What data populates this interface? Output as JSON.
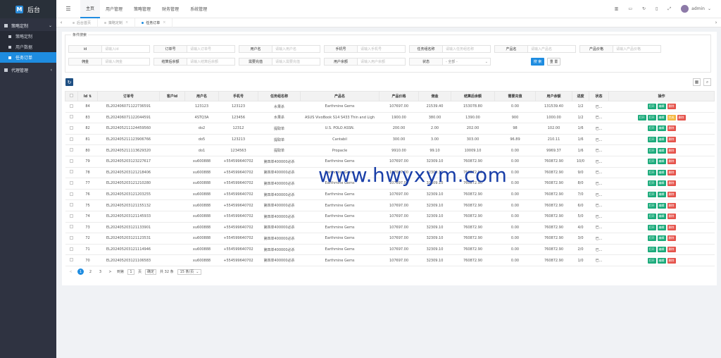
{
  "app": {
    "brand": "后台",
    "brand_logo": "M"
  },
  "sidebar": {
    "groups": [
      {
        "label": "策略定制",
        "expanded": true,
        "items": [
          {
            "label": "策略定制",
            "active": false
          },
          {
            "label": "用户数据",
            "active": false
          },
          {
            "label": "任务订单",
            "active": true
          }
        ]
      },
      {
        "label": "代理管理",
        "expanded": false,
        "items": []
      }
    ]
  },
  "topbar": {
    "nav": [
      "主页",
      "用户管理",
      "策略管理",
      "财务管理",
      "系统管理"
    ],
    "user": "admin"
  },
  "tabs": [
    {
      "label": "后台首页",
      "active": false
    },
    {
      "label": "策略定制",
      "active": false,
      "closable": true
    },
    {
      "label": "任务订单",
      "active": true,
      "closable": true
    }
  ],
  "search": {
    "legend": "条件搜索",
    "row1": [
      {
        "label": "id",
        "placeholder": "请输入id"
      },
      {
        "label": "订单号",
        "placeholder": "请输入订单号"
      },
      {
        "label": "用户名",
        "placeholder": "请输入用户名"
      },
      {
        "label": "手机号",
        "placeholder": "请输入手机号"
      },
      {
        "label": "任务组名称",
        "placeholder": "请输入任务组名称"
      },
      {
        "label": "产品名",
        "placeholder": "请输入产品名"
      },
      {
        "label": "产品价格",
        "placeholder": "请输入产品价格"
      }
    ],
    "row2": [
      {
        "label": "佣金",
        "placeholder": "请输入佣金"
      },
      {
        "label": "结算后余额",
        "placeholder": "请输入结算后余额"
      },
      {
        "label": "需要充值",
        "placeholder": "请输入需要充值"
      },
      {
        "label": "用户余额",
        "placeholder": "请输入用户余额"
      },
      {
        "label": "状态",
        "placeholder": "- 全部 -"
      }
    ],
    "search_btn": "搜 索",
    "reset_btn": "重 置"
  },
  "table": {
    "columns": [
      "Id",
      "订单号",
      "客户id",
      "用户名",
      "手机号",
      "任务组名称",
      "产品名",
      "产品价格",
      "佣金",
      "结算后余额",
      "需要充值",
      "用户余额",
      "进度",
      "状态",
      "操作"
    ],
    "actions": {
      "open": "打开",
      "edit": "编辑",
      "delete": "删除",
      "extra": "完成"
    },
    "rows": [
      [
        "84",
        "EL202406071122736591",
        "",
        "123123",
        "123123",
        "水果杀",
        "Earthmine Gems",
        "107697.00",
        "21539.40",
        "153078.80",
        "0.00",
        "131539.40",
        "1/2",
        "已..."
      ],
      [
        "83",
        "EL202406071122044591",
        "",
        "4STQ3A",
        "123456",
        "水果杀",
        "ASUS VivoBook S14 S433 Thin and Ligh",
        "1900.00",
        "380.00",
        "1390.00",
        "900",
        "1000.00",
        "1/2",
        "已..."
      ],
      [
        "82",
        "EL202405211124459560",
        "",
        "do2",
        "12312",
        "提取单",
        "U.S. POLO ASSN.",
        "200.00",
        "2.00",
        "202.00",
        "98",
        "102.00",
        "1/6",
        "已..."
      ],
      [
        "81",
        "EL202405211123906766",
        "",
        "do5",
        "123213",
        "提取单",
        "Cantabil",
        "300.00",
        "3.00",
        "303.00",
        "96.89",
        "210.11",
        "1/6",
        "已..."
      ],
      [
        "80",
        "EL202405211113629320",
        "",
        "do1",
        "1234563",
        "提取单",
        "Propacle",
        "9910.00",
        "99.10",
        "10009.10",
        "0.00",
        "9969.37",
        "1/6",
        "已..."
      ],
      [
        "79",
        "EL202405203123227617",
        "",
        "xu600888",
        "+554599640702",
        "第四单400000必杀",
        "Earthmine Gems",
        "107697.00",
        "32309.10",
        "760872.90",
        "0.00",
        "760872.90",
        "10/0",
        "已..."
      ],
      [
        "78",
        "EL202405203121218406",
        "",
        "xu600888",
        "+554599640702",
        "第四单400000必杀",
        "Earthmine Gems",
        "107697.00",
        "32309.10",
        "760872.90",
        "0.00",
        "760872.90",
        "9/0",
        "已..."
      ],
      [
        "77",
        "EL202405203121210280",
        "",
        "xu600888",
        "+554599640702",
        "第四单400000必杀",
        "Earthmine Gems",
        "107697.00",
        "32309.10",
        "760872.90",
        "0.00",
        "760872.90",
        "8/0",
        "已..."
      ],
      [
        "76",
        "EL202405203121203255",
        "",
        "xu600888",
        "+554599640702",
        "第四单400000必杀",
        "Earthmine Gems",
        "107697.00",
        "32309.10",
        "760872.90",
        "0.00",
        "760872.90",
        "7/0",
        "已..."
      ],
      [
        "75",
        "EL202405203121155132",
        "",
        "xu600888",
        "+554599640702",
        "第四单400000必杀",
        "Earthmine Gems",
        "107697.00",
        "32309.10",
        "760872.90",
        "0.00",
        "760872.90",
        "6/0",
        "已..."
      ],
      [
        "74",
        "EL202405203121145933",
        "",
        "xu600888",
        "+554599640702",
        "第四单400000必杀",
        "Earthmine Gems",
        "107697.00",
        "32309.10",
        "760872.90",
        "0.00",
        "760872.90",
        "5/0",
        "已..."
      ],
      [
        "73",
        "EL202405203121133901",
        "",
        "xu600888",
        "+554599640702",
        "第四单400000必杀",
        "Earthmine Gems",
        "107697.00",
        "32309.10",
        "760872.90",
        "0.00",
        "760872.90",
        "4/0",
        "已..."
      ],
      [
        "72",
        "EL202405203121123531",
        "",
        "xu600888",
        "+554599640702",
        "第四单400000必杀",
        "Earthmine Gems",
        "107697.00",
        "32309.10",
        "760872.90",
        "0.00",
        "760872.90",
        "3/0",
        "已..."
      ],
      [
        "71",
        "EL202405203121114946",
        "",
        "xu600888",
        "+554599640702",
        "第四单400000必杀",
        "Earthmine Gems",
        "107697.00",
        "32309.10",
        "760872.90",
        "0.00",
        "760872.90",
        "2/0",
        "已..."
      ],
      [
        "70",
        "EL202405203121106583",
        "",
        "xu600888",
        "+554599640702",
        "第四单400000必杀",
        "Earthmine Gems",
        "107697.00",
        "32309.10",
        "760872.90",
        "0.00",
        "760872.90",
        "1/0",
        "已..."
      ]
    ]
  },
  "pager": {
    "prev": "<",
    "pages": [
      "1",
      "2",
      "3"
    ],
    "next": ">",
    "goto_label": "到第",
    "goto_value": "1",
    "page_unit": "页",
    "confirm": "确定",
    "total": "共 32 条",
    "page_size": "15 条/页"
  },
  "watermark": "www.hwyxym.com",
  "colors": {
    "primary": "#1e8ce0",
    "sidebar": "#2f3341",
    "open": "#1aaa7a",
    "edit": "#1aaa7a",
    "delete": "#e5534b",
    "extra": "#f4b841"
  }
}
